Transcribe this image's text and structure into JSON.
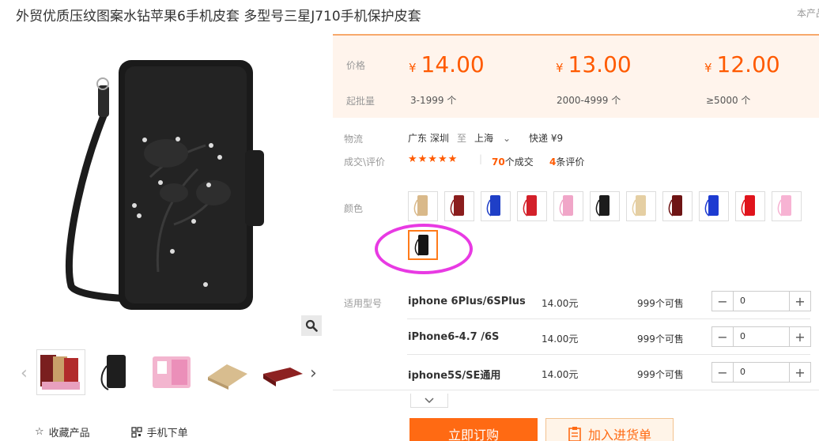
{
  "product": {
    "title": "外贸优质压纹图案水钻苹果6手机皮套 多型号三星J710手机保护皮套",
    "corner_text": "本产品"
  },
  "price_panel": {
    "price_label": "价格",
    "moq_label": "起批量",
    "currency": "¥",
    "tiers": [
      {
        "price": "14.00",
        "range": "3-1999 个"
      },
      {
        "price": "13.00",
        "range": "2000-4999 个"
      },
      {
        "price": "12.00",
        "range": "≥5000 个"
      }
    ]
  },
  "logistics": {
    "label": "物流",
    "from": "广东 深圳",
    "to_word": "至",
    "to": "上海",
    "shipping": "快递 ¥9"
  },
  "reviews": {
    "label": "成交\\评价",
    "stars": "★★★★★",
    "deals_count": "70",
    "deals_suffix": "个成交",
    "review_count": "4",
    "review_suffix": "条评价"
  },
  "color": {
    "label": "颜色",
    "swatches": [
      {
        "name": "beige-gold",
        "color": "#d9b98a"
      },
      {
        "name": "wine-red",
        "color": "#8b1d1d"
      },
      {
        "name": "royal-blue",
        "color": "#1f3fc7"
      },
      {
        "name": "red",
        "color": "#d3202a"
      },
      {
        "name": "pink",
        "color": "#f0a6c8"
      },
      {
        "name": "black",
        "color": "#1c1c1c"
      },
      {
        "name": "champagne",
        "color": "#e5cfa3"
      },
      {
        "name": "dark-red",
        "color": "#6e1414"
      },
      {
        "name": "blue",
        "color": "#1d3bd1"
      },
      {
        "name": "bright-red",
        "color": "#e0141c"
      },
      {
        "name": "light-pink",
        "color": "#f7b3d3"
      },
      {
        "name": "black-selected",
        "color": "#151515"
      }
    ]
  },
  "models": {
    "label": "适用型号",
    "stock_suffix": "个可售",
    "rows": [
      {
        "name": "iphone 6Plus/6SPlus",
        "price": "14.00元",
        "stock": "999",
        "qty": "0"
      },
      {
        "name": "iPhone6-4.7 /6S",
        "price": "14.00元",
        "stock": "999",
        "qty": "0"
      },
      {
        "name": "iphone5S/SE通用",
        "price": "14.00元",
        "stock": "999",
        "qty": "0"
      }
    ]
  },
  "actions": {
    "order": "立即订购",
    "cart": "加入进货单"
  },
  "bottom_links": {
    "favorite": "收藏产品",
    "mobile_order": "手机下单"
  }
}
